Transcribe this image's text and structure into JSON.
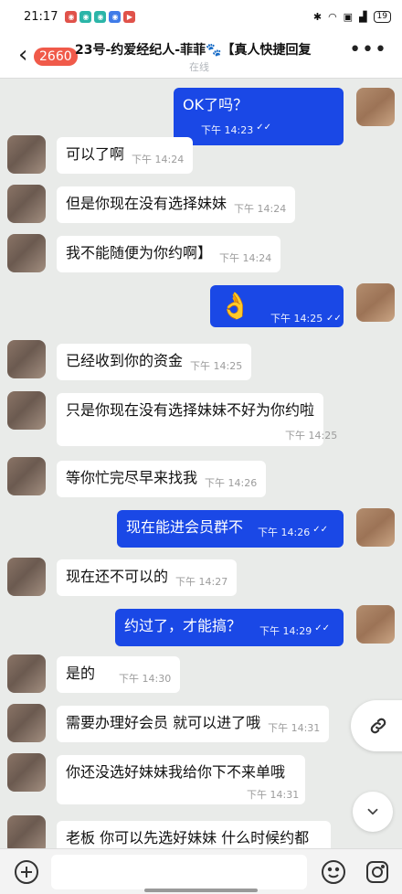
{
  "status_bar": {
    "time": "21:17",
    "battery": "19"
  },
  "header": {
    "unread_count": "2660",
    "title": "23号-约爱经纪人-菲菲🐾【真人快捷回复",
    "subtitle": "在线"
  },
  "messages": [
    {
      "side": "me",
      "text": "OK了吗？",
      "time": "下午 14:23"
    },
    {
      "side": "them",
      "text": "可以了啊",
      "time": "下午 14:24"
    },
    {
      "side": "them",
      "text": "但是你现在没有选择妹妹",
      "time": "下午 14:24"
    },
    {
      "side": "them",
      "text": "我不能随便为你约啊】",
      "time": "下午 14:24"
    },
    {
      "side": "me",
      "text": "👌",
      "time": "下午 14:25"
    },
    {
      "side": "them",
      "text": "已经收到你的资金",
      "time": "下午 14:25"
    },
    {
      "side": "them",
      "text": "只是你现在没有选择妹妹不好为你约啦",
      "time": "下午 14:25"
    },
    {
      "side": "them",
      "text": "等你忙完尽早来找我",
      "time": "下午 14:26"
    },
    {
      "side": "me",
      "text": "现在能进会员群不",
      "time": "下午 14:26"
    },
    {
      "side": "them",
      "text": "现在还不可以的",
      "time": "下午 14:27"
    },
    {
      "side": "me",
      "text": "约过了，才能搞？",
      "time": "下午 14:29"
    },
    {
      "side": "them",
      "text": "是的",
      "time": "下午 14:30"
    },
    {
      "side": "them",
      "text": "需要办理好会员 就可以进了哦",
      "time": "下午 14:31"
    },
    {
      "side": "them",
      "text": "你还没选好妹妹我给你下不来单哦",
      "time": "下午 14:31"
    },
    {
      "side": "them",
      "text": "老板 你可以先选好妹妹 什么时候约都",
      "time": ""
    }
  ],
  "icons": {
    "back": "chevron-left-icon",
    "more": "more-icon",
    "link": "link-icon",
    "scroll_down": "chevron-down-icon",
    "add": "plus-circle-icon",
    "emoji": "emoji-icon",
    "camera": "camera-icon"
  },
  "colors": {
    "my_bubble": "#1a48e6",
    "their_bubble": "#ffffff",
    "badge": "#f05a4a"
  }
}
